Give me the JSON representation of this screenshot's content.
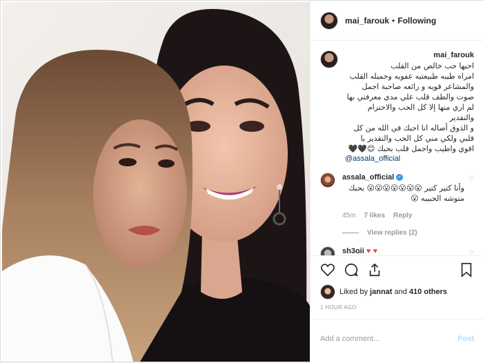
{
  "header": {
    "username": "mai_farouk",
    "separator": "•",
    "follow_status": "Following"
  },
  "caption": {
    "author": "mai_farouk",
    "text": "احبها حب خالص من القلب\nامراه طيبه طبيعتيه عفويه وجميله القلب\nوالمشاعر قويه و رائعه صاحبة اجمل\nصوت والطف قلب علي مدي معرفتي بها\nلم اري منها إلا كل الحب والاحترام والتقدير\nو الذوق أصاله انا احبك في الله من كل\nقلبي ولكي مني كل الحب والتقدير يا\nاقوي واطيب واجمل قلب بحبك 😊🖤🖤",
    "mention": "@assala_official"
  },
  "comments": [
    {
      "author": "assala_official",
      "verified": true,
      "text": "وأنا كتير كتير 😮😮😮😮😮😮😮 بحبك متوشه الحبيبه 😮",
      "time": "45m",
      "likes": "7 likes",
      "reply": "Reply",
      "view_replies": "View replies (2)"
    },
    {
      "author": "sh3oii",
      "text": "♥ ♥"
    }
  ],
  "likes": {
    "prefix": "Liked by",
    "user": "jannat",
    "connector": "and",
    "others": "410 others"
  },
  "time_ago": "1 HOUR AGO",
  "add_comment": {
    "placeholder": "Add a comment...",
    "post_label": "Post"
  }
}
